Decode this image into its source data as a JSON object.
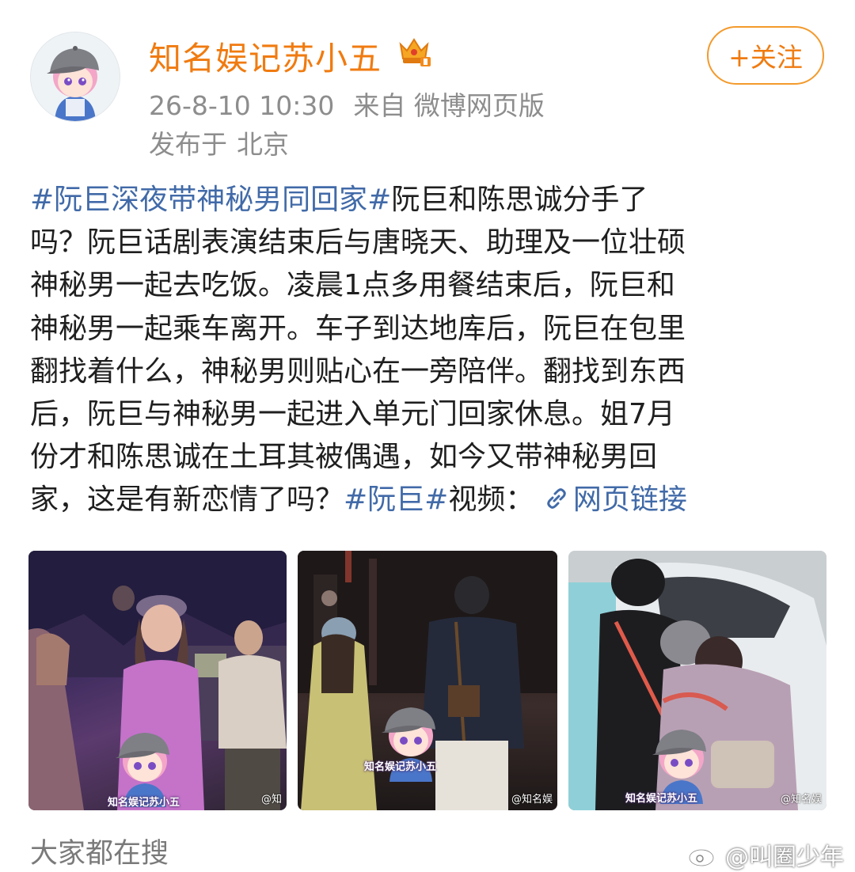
{
  "header": {
    "username": "知名娱记苏小五",
    "follow_label": "+关注",
    "post_time": "26-8-10 10:30",
    "source": "来自 微博网页版",
    "location_label": "发布于",
    "location": "北京",
    "accent_color": "#f07b10"
  },
  "post": {
    "lines": [
      [
        "#阮巨深夜带神秘男同回家#",
        "阮巨和陈思诚分手了"
      ],
      [
        "吗？阮巨话剧表演结束后与唐晓天、助理及一位壮硕"
      ],
      [
        "神秘男一起去吃饭。凌晨1点多用餐结束后，阮巨和"
      ],
      [
        "神秘男一起乘车离开。车子到达地库后，阮巨在包里"
      ],
      [
        "翻找着什么，神秘男则贴心在一旁陪伴。翻找到东西"
      ],
      [
        "后，阮巨与神秘男一起进入单元门回家休息。姐7月"
      ],
      [
        "份才和陈思诚在土耳其被偶遇，如今又带神秘男回"
      ]
    ],
    "last_line_prefix": "家，这是有新恋情了吗？",
    "last_line_tag": "#阮巨#",
    "last_line_suffix": "视频：",
    "link_label": "网页链接",
    "tag_color": "#416aa8"
  },
  "photos": {
    "watermark_caption": "知名娱记苏小五",
    "small_watermarks": [
      "@知",
      "@知名娱",
      "@知名娱"
    ]
  },
  "footer": {
    "search_label": "大家都在搜",
    "corner_watermark": "@叫圈少年"
  }
}
